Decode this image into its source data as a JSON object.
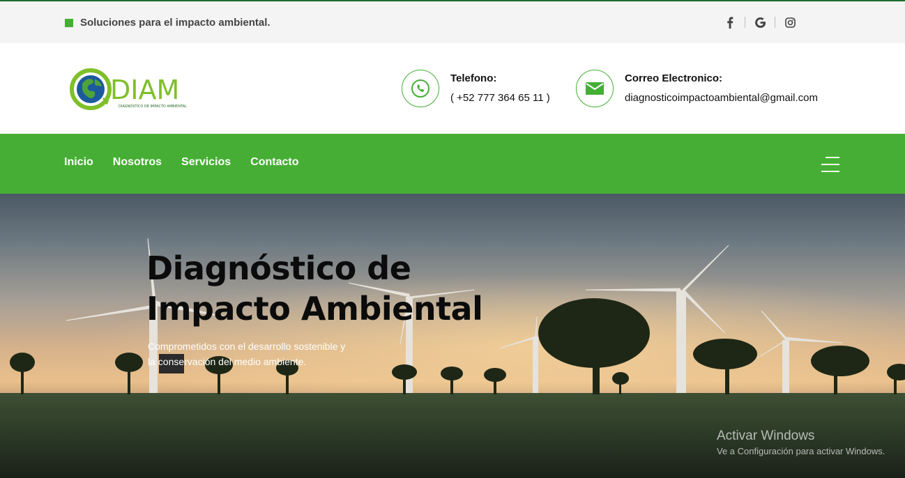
{
  "topbar": {
    "tagline": "Soluciones para el impacto ambiental.",
    "social_icons": [
      "facebook-icon",
      "google-icon",
      "instagram-icon"
    ]
  },
  "header": {
    "logo_text": "DIAM",
    "logo_subtext": "DIAGNÓSTICO DE IMPACTO AMBIENTAL",
    "phone": {
      "label": "Telefono:",
      "value": "( +52 777 364 65 11 )",
      "icon": "phone-icon"
    },
    "email": {
      "label": "Correo Electronico:",
      "value": "diagnosticoimpactoambiental@gmail.com",
      "icon": "mail-icon"
    }
  },
  "nav": {
    "items": [
      "Inicio",
      "Nosotros",
      "Servicios",
      "Contacto"
    ],
    "menu_icon": "hamburger-menu-icon"
  },
  "hero": {
    "title_line1": "Diagnóstico de",
    "title_line2": "Impacto Ambiental",
    "subtitle_line1": "Comprometidos con el desarrollo sostenible y",
    "subtitle_line2": "la conservación del medio ambiente."
  },
  "watermark": {
    "title": "Activar Windows",
    "subtitle": "Ve a Configuración para activar Windows."
  },
  "colors": {
    "brand_green": "#46ae34",
    "dark_green": "#1f6b2c",
    "text_dark": "#111111"
  }
}
